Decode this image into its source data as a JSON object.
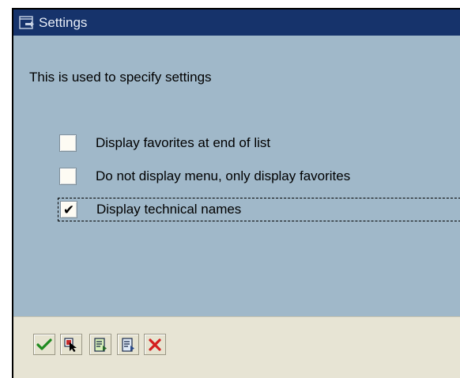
{
  "dialog": {
    "title": "Settings",
    "description": "This is used to specify settings"
  },
  "options": [
    {
      "label": "Display favorites at end of list",
      "checked": false
    },
    {
      "label": "Do not display menu, only display favorites",
      "checked": false
    },
    {
      "label": "Display technical names",
      "checked": true
    }
  ],
  "checkmark": "✔",
  "toolbar": {
    "buttons": [
      {
        "icon": "green-checkmark-icon"
      },
      {
        "icon": "select-cursor-icon"
      },
      {
        "icon": "document-green-icon"
      },
      {
        "icon": "document-blue-icon"
      },
      {
        "icon": "red-x-icon"
      }
    ]
  },
  "colors": {
    "titlebar": "#16336b",
    "body": "#a0b8c9",
    "toolbar": "#e7e4d4"
  }
}
